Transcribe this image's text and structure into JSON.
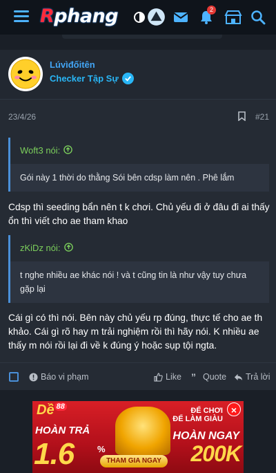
{
  "site": {
    "logo_prefix": "R",
    "logo_rest": "phang",
    "notification_count": "2"
  },
  "nav_icons": [
    "menu-icon",
    "theme-toggle-icon",
    "user-icon",
    "mail-icon",
    "bell-icon",
    "store-icon",
    "search-icon"
  ],
  "post": {
    "author": {
      "name": "Lúvìđốitên",
      "title": "Checker Tập Sự"
    },
    "date": "23/4/26",
    "number": "#21",
    "quotes": [
      {
        "author": "Woft3 nói:",
        "text": "Gói này 1 thời do thằng Sói bên cdsp làm nên . Phê lắm"
      },
      {
        "author": "zKiDz nói:",
        "text": "t nghe nhiều ae khác nói ! và t cũng tin là như vậy tuy chưa gặp lại"
      }
    ],
    "reply1": "Cdsp thì seeding bẩn nên t k chơi. Chủ yếu đi ở đâu đi ai thấy ổn thì viết cho ae tham khao",
    "reply2": "Cái gì có thì nói. Bên này chủ yếu rp đúng, thực tế cho ae th khảo. Cái gì rõ hay m trải nghiệm rồi thì hãy nói. K nhiều ae thấy m nói rồi lại đi về k đúng ý hoặc sụp tội ngta.",
    "actions": {
      "report": "Báo vi phạm",
      "like": "Like",
      "quote": "Quote",
      "reply": "Trả lời"
    }
  },
  "ad": {
    "brand": "Dề",
    "brand_num": "88",
    "left_line1": "HOÀN TRẢ",
    "left_big": "1.6",
    "percent": "%",
    "right_top": "ĐỂ CHƠI\nĐỂ LÀM GIÀU",
    "right_line": "HOÀN NGAY",
    "right_big": "200K",
    "cta": "THAM GIA NGAY",
    "close": "×"
  },
  "colors": {
    "accent": "#42a5f5",
    "quote_author": "#7ccf5c",
    "background": "#1a1f27",
    "card": "#252b34"
  }
}
